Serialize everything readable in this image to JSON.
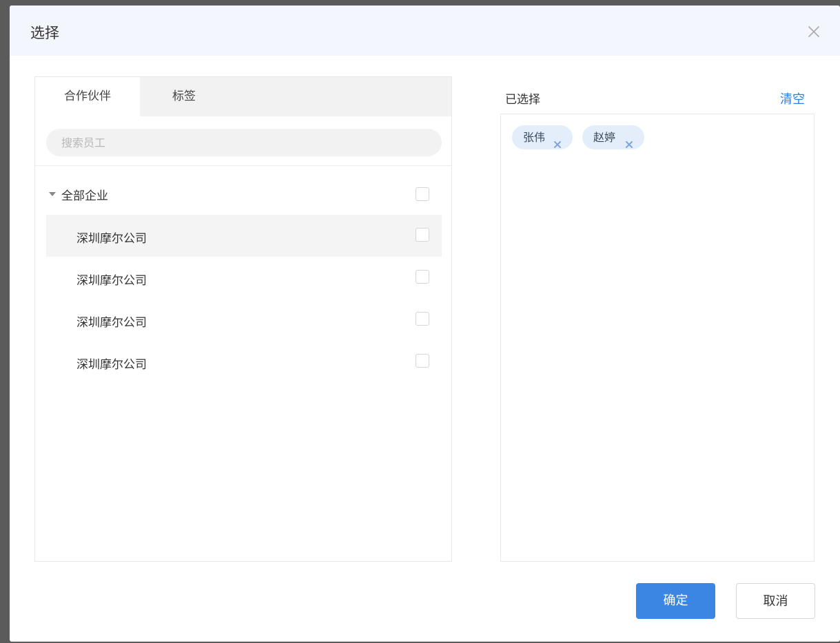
{
  "dialog": {
    "title": "选择"
  },
  "tabs": [
    {
      "label": "合作伙伴",
      "active": true
    },
    {
      "label": "标签",
      "active": false
    }
  ],
  "search": {
    "placeholder": "搜索员工"
  },
  "tree": {
    "root_label": "全部企业",
    "items": [
      {
        "label": "深圳摩尔公司",
        "hover": true
      },
      {
        "label": "深圳摩尔公司"
      },
      {
        "label": "深圳摩尔公司"
      },
      {
        "label": "深圳摩尔公司"
      }
    ]
  },
  "selected": {
    "title": "已选择",
    "clear_label": "清空",
    "chips": [
      {
        "label": "张伟"
      },
      {
        "label": "赵婷"
      }
    ]
  },
  "footer": {
    "ok_label": "确定",
    "cancel_label": "取消"
  },
  "colors": {
    "accent": "#3b86e3",
    "link": "#2f7ddf",
    "header_bg": "#f3f6fc",
    "chip_bg": "#e4eefb"
  },
  "icons": {
    "close": "close-icon",
    "caret": "caret-down-icon",
    "chip_remove": "close-icon"
  }
}
